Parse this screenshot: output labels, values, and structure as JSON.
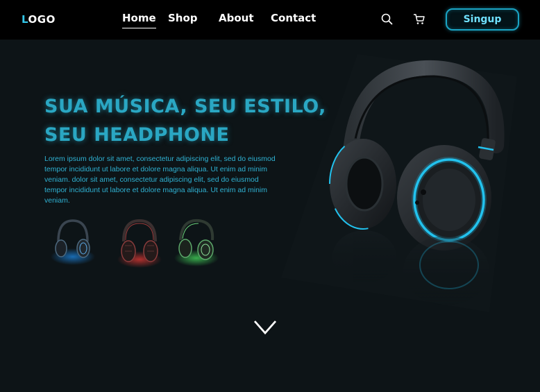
{
  "nav": {
    "logo_first": "L",
    "logo_rest": "OGO",
    "links": [
      "Home",
      "Shop",
      "About",
      "Contact"
    ],
    "active": "Home",
    "signup_label": "Singup"
  },
  "icons": {
    "search": "search-icon",
    "cart": "cart-icon",
    "scroll": "chevron-down-icon"
  },
  "hero": {
    "title_line1": "SUA MÚSICA, SEU ESTILO,",
    "title_line2": "SEU HEADPHONE",
    "description": [
      "Lorem ipsum dolor sit amet, consectetur adipiscing elit, sed do eiusmod",
      " tempor incididunt ut labore et dolore magna aliqua. Ut enim ad minim",
      "veniam. dolor sit amet, consectetur adipiscing elit, sed do eiusmod",
      " tempor incididunt ut labore et dolore magna aliqua. Ut enim ad minim",
      "veniam."
    ]
  },
  "thumbnails": [
    {
      "name": "blue",
      "color": "#1e88e5"
    },
    {
      "name": "red",
      "color": "#e53935"
    },
    {
      "name": "green",
      "color": "#43d35a"
    }
  ],
  "colors": {
    "accent": "#2aa7c3",
    "background": "#0d1417",
    "navbar": "#000000"
  }
}
